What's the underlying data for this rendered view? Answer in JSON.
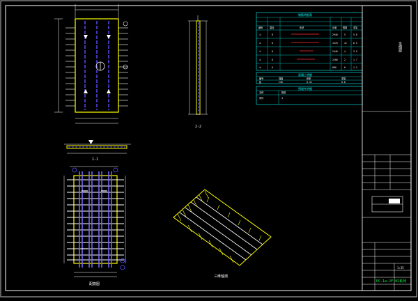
{
  "drawing": {
    "view_labels": {
      "section_a": "1-1",
      "section_b": "2-2",
      "plan": "配筋图",
      "iso": "三维轴测"
    },
    "rebar_table": {
      "title": "钢筋明细表",
      "header": [
        "编号",
        "直径",
        "形状",
        "长度",
        "根数",
        "重量"
      ],
      "rows": [
        [
          "①",
          "8",
          "",
          "2940",
          "5",
          "5.8"
        ],
        [
          "②",
          "8",
          "",
          "1370",
          "12",
          "6.5"
        ],
        [
          "③",
          "8",
          "",
          "2440",
          "4",
          "3.9"
        ],
        [
          "④",
          "8",
          "",
          "2200",
          "2",
          "1.7"
        ],
        [
          "⑤",
          "6",
          "",
          "880",
          "6",
          "1.2"
        ]
      ]
    },
    "concrete_table": {
      "title": "混凝土明细",
      "header": [
        "编号",
        "强度",
        "体积",
        "重量"
      ],
      "rows": [
        [
          "批",
          "C30",
          "0.32",
          "0.8"
        ]
      ]
    },
    "embed_table": {
      "title": "预埋件明细",
      "header": [
        "名称",
        "数量"
      ],
      "rows": [
        [
          "吊件",
          "4"
        ]
      ]
    },
    "title_block": {
      "drawing_number": "PC-1a-2F-02系列",
      "stamp": "见细部",
      "scale": "1:25"
    }
  }
}
